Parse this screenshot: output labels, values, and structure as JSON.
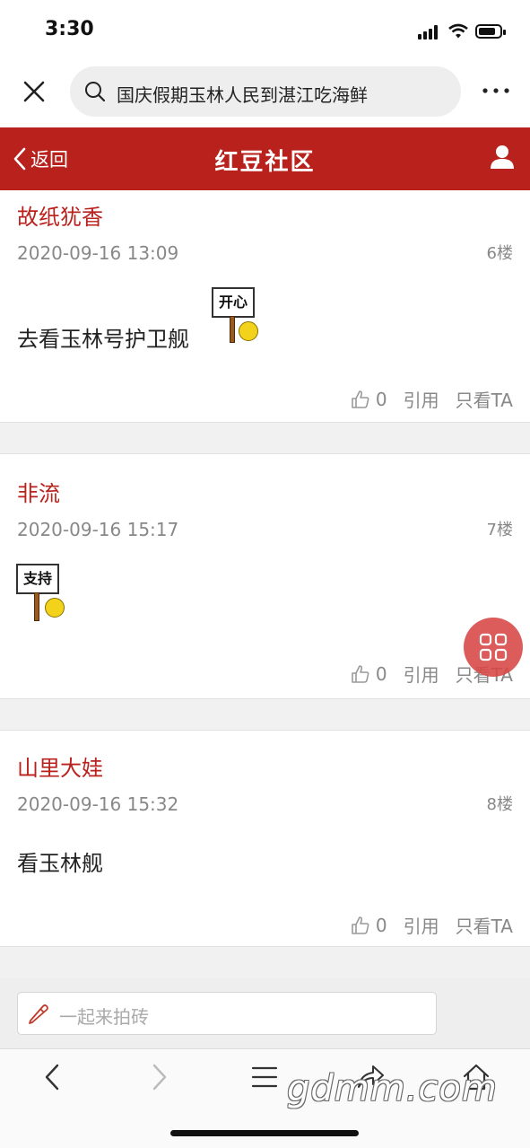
{
  "status": {
    "time": "3:30"
  },
  "browser": {
    "search_text": "国庆假期玉林人民到湛江吃海鲜"
  },
  "nav": {
    "back_label": "返回",
    "title": "红豆社区"
  },
  "posts": [
    {
      "author": "故纸犹香",
      "time": "2020-09-16 13:09",
      "floor": "6楼",
      "text": "去看玉林号护卫舰",
      "sticker": "开心",
      "likes": "0",
      "quote": "引用",
      "only_ta": "只看TA"
    },
    {
      "author": "非流",
      "time": "2020-09-16 15:17",
      "floor": "7楼",
      "text": "",
      "sticker": "支持",
      "likes": "0",
      "quote": "引用",
      "only_ta": "只看TA"
    },
    {
      "author": "山里大娃",
      "time": "2020-09-16 15:32",
      "floor": "8楼",
      "text": "看玉林舰",
      "likes": "0",
      "quote": "引用",
      "only_ta": "只看TA"
    }
  ],
  "reply": {
    "placeholder": "一起来拍砖"
  },
  "watermark": "gdmm.com",
  "colors": {
    "brand": "#b8211c",
    "float_button": "#d74646"
  }
}
